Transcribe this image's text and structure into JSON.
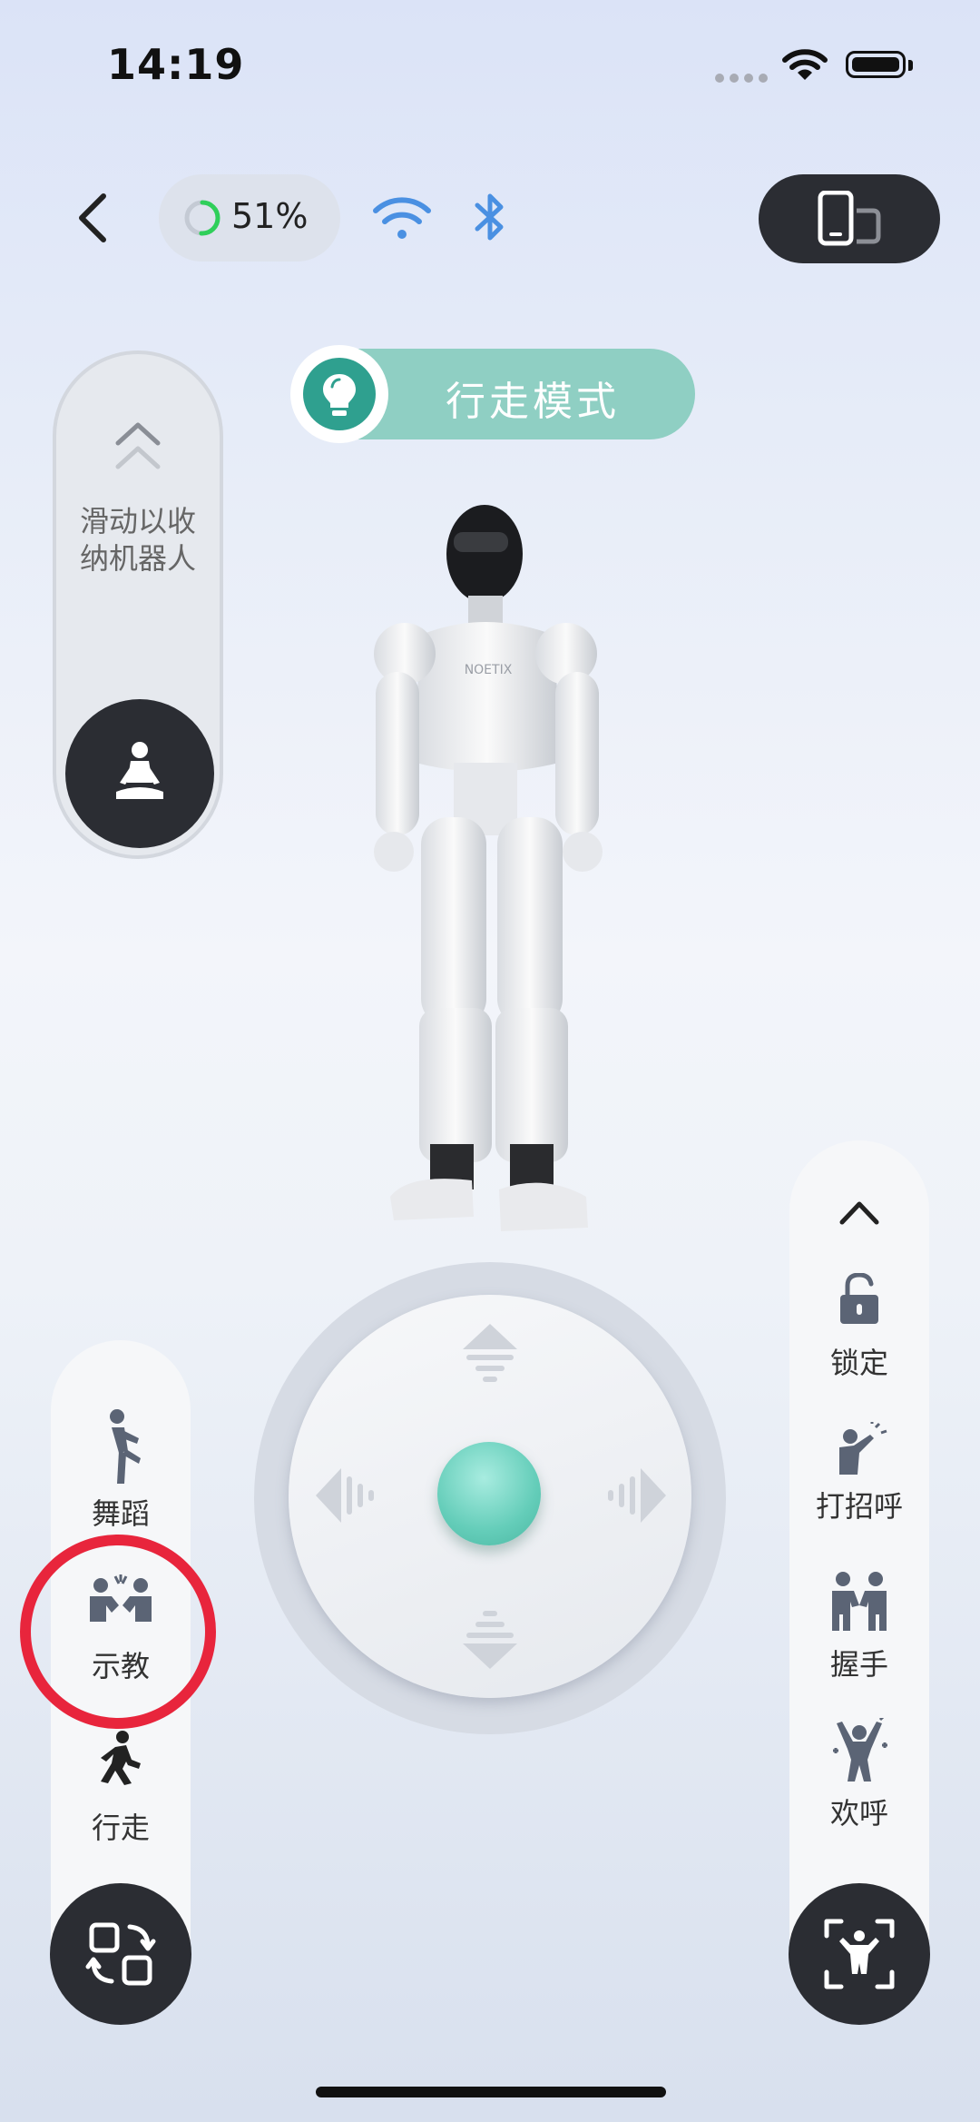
{
  "status_bar": {
    "time": "14:19"
  },
  "top_bar": {
    "battery_percent_label": "51%",
    "battery_level": 0.51
  },
  "mode": {
    "label": "行走模式"
  },
  "stow_slider": {
    "hint": "滑动以收纳机器人"
  },
  "left_actions": [
    {
      "label": "舞蹈",
      "icon": "dance-icon"
    },
    {
      "label": "示教",
      "icon": "teach-icon"
    },
    {
      "label": "行走",
      "icon": "walk-icon"
    }
  ],
  "right_actions": [
    {
      "label": "锁定",
      "icon": "lock-icon"
    },
    {
      "label": "打招呼",
      "icon": "wave-icon"
    },
    {
      "label": "握手",
      "icon": "handshake-icon"
    },
    {
      "label": "欢呼",
      "icon": "cheer-icon"
    }
  ],
  "robot_brand": "NOETIX",
  "colors": {
    "accent": "#8fcfc3",
    "accent_dark": "#2fa08f",
    "dark_button": "#2b2d33",
    "highlight_ring": "#e8253c",
    "bluetooth": "#4a90e2"
  }
}
